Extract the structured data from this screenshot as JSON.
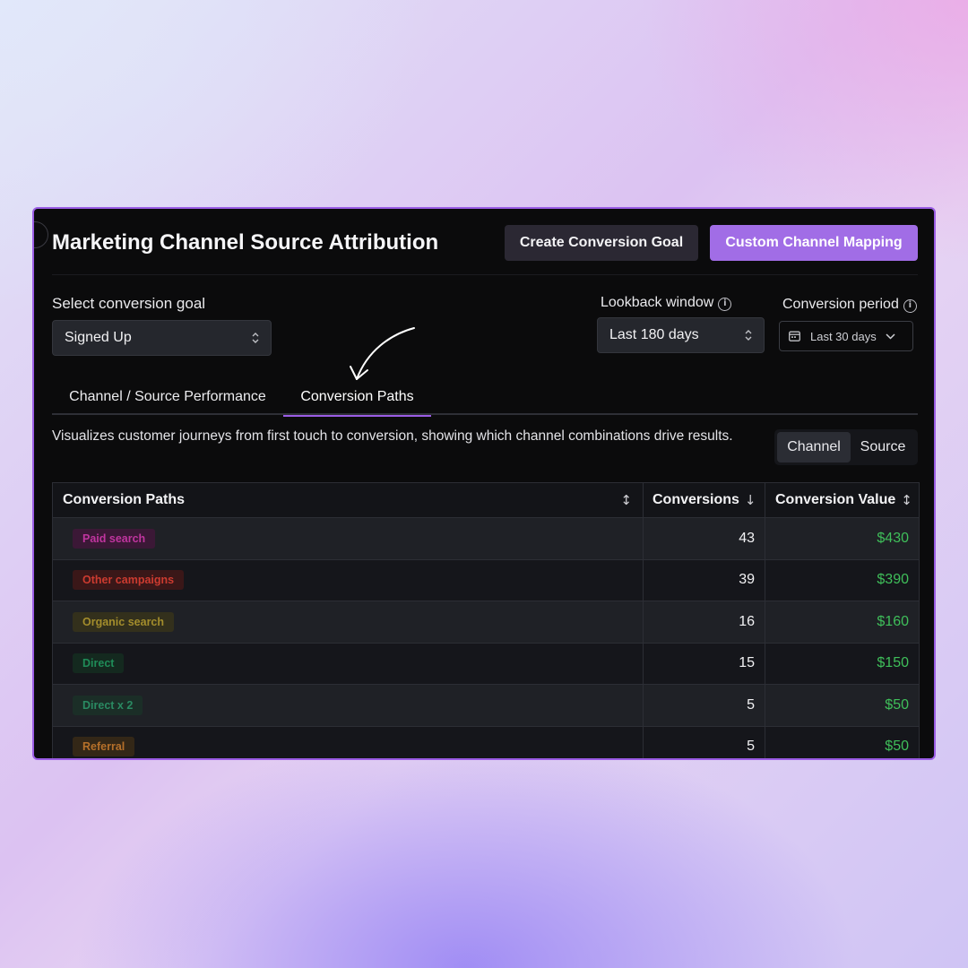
{
  "page": {
    "title": "Marketing Channel Source Attribution",
    "buttons": {
      "create_goal": "Create Conversion Goal",
      "channel_mapping": "Custom Channel Mapping"
    }
  },
  "filters": {
    "goal_label": "Select conversion goal",
    "goal_value": "Signed Up",
    "lookback_label": "Lookback window",
    "lookback_value": "Last 180 days",
    "period_label": "Conversion period",
    "period_value": "Last 30 days"
  },
  "tabs": [
    {
      "label": "Channel / Source Performance",
      "active": false
    },
    {
      "label": "Conversion Paths",
      "active": true
    }
  ],
  "description": "Visualizes customer journeys from first touch to conversion, showing which channel combinations drive results.",
  "toggle": {
    "options": [
      "Channel",
      "Source"
    ],
    "selected": "Channel"
  },
  "table": {
    "headers": {
      "path": "Conversion Paths",
      "conversions": "Conversions",
      "value": "Conversion Value"
    },
    "rows": [
      {
        "path": "Paid search",
        "conversions": "43",
        "value": "$430",
        "badge_bg": "#3b1836",
        "badge_fg": "#c0359f"
      },
      {
        "path": "Other campaigns",
        "conversions": "39",
        "value": "$390",
        "badge_bg": "#3a1718",
        "badge_fg": "#cc3b30"
      },
      {
        "path": "Organic search",
        "conversions": "16",
        "value": "$160",
        "badge_bg": "#33301c",
        "badge_fg": "#a38d2c"
      },
      {
        "path": "Direct",
        "conversions": "15",
        "value": "$150",
        "badge_bg": "#14291f",
        "badge_fg": "#1f8c58"
      },
      {
        "path": "Direct x 2",
        "conversions": "5",
        "value": "$50",
        "badge_bg": "#1b2e27",
        "badge_fg": "#2a8a62"
      },
      {
        "path": "Referral",
        "conversions": "5",
        "value": "$50",
        "badge_bg": "#332717",
        "badge_fg": "#b5702a"
      }
    ]
  },
  "colors": {
    "accent": "#9b5de5",
    "positive_value": "#3fbf5a",
    "panel_bg": "#0b0b0c"
  }
}
